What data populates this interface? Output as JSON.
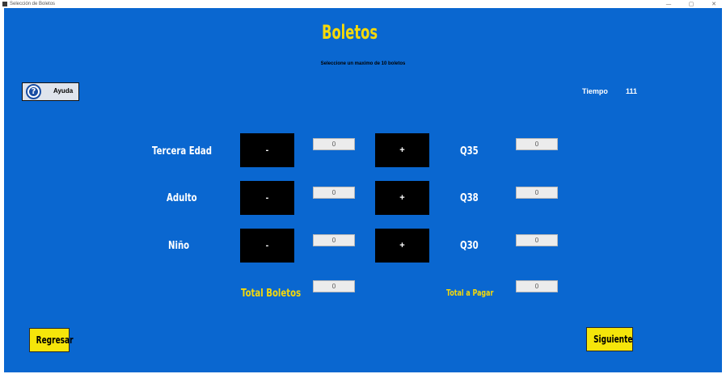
{
  "window": {
    "title": "Selección de Boletos",
    "minimize_glyph": "—",
    "maximize_glyph": "▢",
    "close_glyph": "✕"
  },
  "header": {
    "title": "Boletos",
    "subtitle": "Seleccione un maximo de 10 boletos"
  },
  "help": {
    "label": "Ayuda",
    "icon_glyph": "?",
    "icon": "question-circle-icon"
  },
  "timer": {
    "label": "Tiempo",
    "value": "111"
  },
  "rows": [
    {
      "label": "Tercera Edad",
      "minus_label": "-",
      "plus_label": "+",
      "quantity": "0",
      "price": "Q35",
      "subtotal": "0"
    },
    {
      "label": "Adulto",
      "minus_label": "-",
      "plus_label": "+",
      "quantity": "0",
      "price": "Q38",
      "subtotal": "0"
    },
    {
      "label": "Niño",
      "minus_label": "-",
      "plus_label": "+",
      "quantity": "0",
      "price": "Q30",
      "subtotal": "0"
    }
  ],
  "totals": {
    "boletos_label": "Total Boletos",
    "boletos_value": "0",
    "pagar_label": "Total a Pagar",
    "pagar_value": "0"
  },
  "nav": {
    "back_label": "Regresar",
    "next_label": "Siguiente"
  },
  "colors": {
    "background": "#0a67d0",
    "accent_yellow": "#f5d90a",
    "button_black": "#000000",
    "button_yellow": "#f5e50a"
  }
}
